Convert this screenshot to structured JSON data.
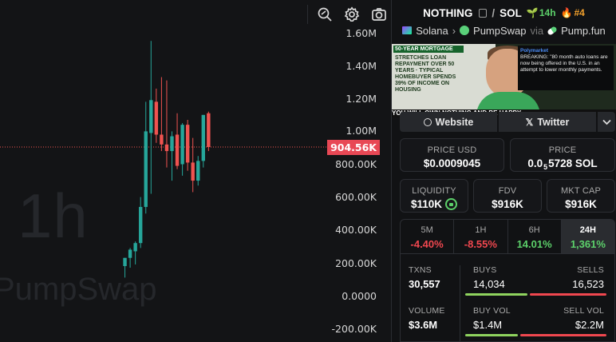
{
  "chart": {
    "interval_watermark": "1h",
    "source_watermark": "PumpSwap",
    "current_price_label": "904.56K",
    "y_ticks": [
      "1.60M",
      "1.40M",
      "1.20M",
      "1.00M",
      "800.00K",
      "600.00K",
      "400.00K",
      "200.00K",
      "0.0000",
      "-200.00K"
    ],
    "toolbar": [
      "crosshair-search-icon",
      "settings-icon",
      "camera-icon"
    ],
    "colors": {
      "up": "#26a69a",
      "down": "#ef5350",
      "price_line": "#ef5350"
    }
  },
  "chart_data": {
    "type": "candlestick",
    "ylim": [
      -230000,
      1640000
    ],
    "candles": [
      {
        "o": 0,
        "h": 0,
        "l": 0,
        "c": 0,
        "up": true
      },
      {
        "o": 180000,
        "h": 230000,
        "l": 110000,
        "c": 230000,
        "up": true
      },
      {
        "o": 230000,
        "h": 290000,
        "l": 170000,
        "c": 280000,
        "up": true
      },
      {
        "o": 270000,
        "h": 330000,
        "l": 190000,
        "c": 320000,
        "up": true
      },
      {
        "o": 320000,
        "h": 600000,
        "l": 290000,
        "c": 540000,
        "up": true
      },
      {
        "o": 540000,
        "h": 1180000,
        "l": 500000,
        "c": 1000000,
        "up": true
      },
      {
        "o": 990000,
        "h": 1550000,
        "l": 620000,
        "c": 1190000,
        "up": true
      },
      {
        "o": 1180000,
        "h": 1260000,
        "l": 930000,
        "c": 980000,
        "up": false
      },
      {
        "o": 980000,
        "h": 1330000,
        "l": 880000,
        "c": 920000,
        "up": false
      },
      {
        "o": 920000,
        "h": 1310000,
        "l": 780000,
        "c": 880000,
        "up": false
      },
      {
        "o": 880000,
        "h": 1000000,
        "l": 700000,
        "c": 970000,
        "up": true
      },
      {
        "o": 980000,
        "h": 1110000,
        "l": 770000,
        "c": 790000,
        "up": false
      },
      {
        "o": 800000,
        "h": 1050000,
        "l": 730000,
        "c": 1040000,
        "up": true
      },
      {
        "o": 1040000,
        "h": 1070000,
        "l": 760000,
        "c": 810000,
        "up": false
      },
      {
        "o": 810000,
        "h": 960000,
        "l": 630000,
        "c": 700000,
        "up": false
      },
      {
        "o": 700000,
        "h": 850000,
        "l": 670000,
        "c": 820000,
        "up": true
      },
      {
        "o": 820000,
        "h": 1100000,
        "l": 780000,
        "c": 1100000,
        "up": true
      },
      {
        "o": 1110000,
        "h": 1120000,
        "l": 880000,
        "c": 904560,
        "up": false
      }
    ],
    "current_price": 904560
  },
  "header": {
    "base_token": "NOTHING",
    "separator": "/",
    "quote_token": "SOL",
    "age": "14h",
    "rank": "#4",
    "chain": "Solana",
    "dex": "PumpSwap",
    "via_label": "via",
    "launchpad": "Pump.fun"
  },
  "banner": {
    "headline": "50-YEAR MORTGAGE",
    "left_text": "STRETCHES LOAN REPAYMENT OVER 50 YEARS · TYPICAL HOMEBUYER SPENDS 39% OF INCOME ON HOUSING",
    "tweet_author": "Polymarket",
    "tweet_text": "BREAKING: \"80 month auto loans are now being offered in the U.S. in an attempt to lower monthly payments.",
    "ticker_text": "YOU WILL OWN NOTHING AND BE HAPPY"
  },
  "links": {
    "website": "Website",
    "twitter": "Twitter"
  },
  "price_cards": {
    "usd_label": "PRICE USD",
    "usd_value": "$0.0009045",
    "native_label": "PRICE",
    "native_prefix": "0.0",
    "native_zeros": "5",
    "native_rest": "5728 SOL"
  },
  "metrics": {
    "liquidity_label": "LIQUIDITY",
    "liquidity_value": "$110K",
    "fdv_label": "FDV",
    "fdv_value": "$916K",
    "mcap_label": "MKT CAP",
    "mcap_value": "$916K"
  },
  "changes": [
    {
      "label": "5M",
      "value": "-4.40%",
      "dir": "neg"
    },
    {
      "label": "1H",
      "value": "-8.55%",
      "dir": "neg"
    },
    {
      "label": "6H",
      "value": "14.01%",
      "dir": "pos"
    },
    {
      "label": "24H",
      "value": "1,361%",
      "dir": "pos",
      "active": true
    }
  ],
  "stats": {
    "txns_label": "TXNS",
    "txns_value": "30,557",
    "buys_label": "BUYS",
    "buys_value": "14,034",
    "sells_label": "SELLS",
    "sells_value": "16,523",
    "volume_label": "VOLUME",
    "volume_value": "$3.6M",
    "buy_vol_label": "BUY VOL",
    "buy_vol_value": "$1.4M",
    "sell_vol_label": "SELL VOL",
    "sell_vol_value": "$2.2M",
    "buys_ratio": 0.46,
    "buy_vol_ratio": 0.39,
    "colors": {
      "buy": "#8fd35e",
      "sell": "#f0474f"
    }
  }
}
